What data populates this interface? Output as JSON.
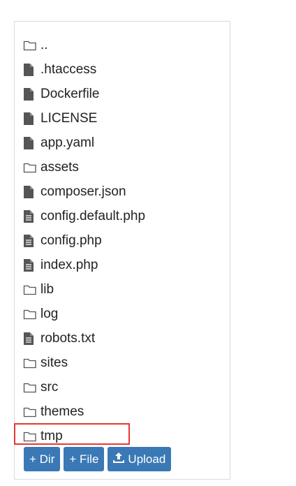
{
  "files": [
    {
      "name": "..",
      "type": "folder"
    },
    {
      "name": ".htaccess",
      "type": "file"
    },
    {
      "name": "Dockerfile",
      "type": "file"
    },
    {
      "name": "LICENSE",
      "type": "file"
    },
    {
      "name": "app.yaml",
      "type": "file"
    },
    {
      "name": "assets",
      "type": "folder"
    },
    {
      "name": "composer.json",
      "type": "file"
    },
    {
      "name": "config.default.php",
      "type": "text-file"
    },
    {
      "name": "config.php",
      "type": "text-file"
    },
    {
      "name": "index.php",
      "type": "text-file"
    },
    {
      "name": "lib",
      "type": "folder"
    },
    {
      "name": "log",
      "type": "folder"
    },
    {
      "name": "robots.txt",
      "type": "text-file"
    },
    {
      "name": "sites",
      "type": "folder"
    },
    {
      "name": "src",
      "type": "folder"
    },
    {
      "name": "themes",
      "type": "folder"
    },
    {
      "name": "tmp",
      "type": "folder"
    }
  ],
  "toolbar": {
    "new_dir_label": "+ Dir",
    "new_file_label": "+ File",
    "upload_label": "Upload"
  },
  "colors": {
    "button_bg": "#3a79b5",
    "highlight": "#e53935",
    "icon": "#555555"
  }
}
